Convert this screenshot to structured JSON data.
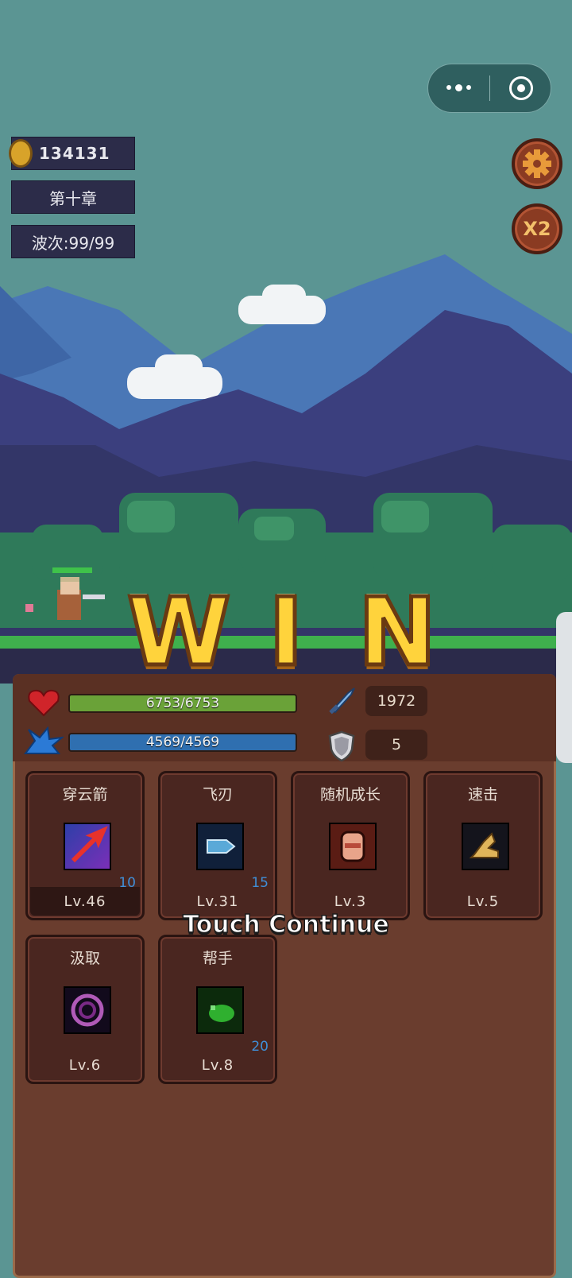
{
  "hud": {
    "coins": "134131",
    "chapter": "第十章",
    "wave": "波次:99/99"
  },
  "buttons": {
    "speed_label": "X2"
  },
  "result": {
    "win_letters": [
      "W",
      "I",
      "N"
    ],
    "continue_text": "Touch Continue"
  },
  "stats": {
    "hp_text": "6753/6753",
    "hp_fill": 1.0,
    "mp_text": "4569/4569",
    "mp_fill": 1.0,
    "attack": "1972",
    "defense": "5"
  },
  "skills": [
    {
      "name": "穿云箭",
      "level": "Lv.46",
      "count": "10",
      "icon": "arrow-icon"
    },
    {
      "name": "飞刃",
      "level": "Lv.31",
      "count": "15",
      "icon": "flying-blade-icon"
    },
    {
      "name": "随机成长",
      "level": "Lv.3",
      "count": "",
      "icon": "fist-icon"
    },
    {
      "name": "速击",
      "level": "Lv.5",
      "count": "",
      "icon": "boot-icon"
    },
    {
      "name": "汲取",
      "level": "Lv.6",
      "count": "",
      "icon": "vortex-icon"
    },
    {
      "name": "帮手",
      "level": "Lv.8",
      "count": "20",
      "icon": "slime-icon"
    }
  ],
  "colors": {
    "gold": "#ffd33c",
    "hp_bar": "#6aa238",
    "mp_bar": "#2f6fb0",
    "panel": "#6a3d2e"
  }
}
